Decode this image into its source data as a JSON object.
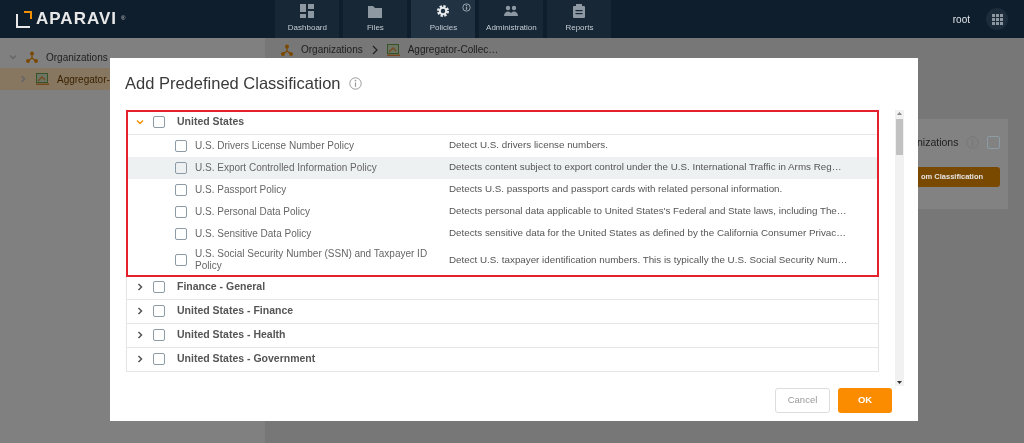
{
  "app": {
    "logo_text": "APARAVI",
    "logo_mark": "®",
    "user": "root"
  },
  "nav": [
    {
      "label": "Dashboard",
      "selected": false,
      "info": false
    },
    {
      "label": "Files",
      "selected": false,
      "info": false
    },
    {
      "label": "Policies",
      "selected": true,
      "info": true
    },
    {
      "label": "Administration",
      "selected": false,
      "info": false
    },
    {
      "label": "Reports",
      "selected": false,
      "info": false
    }
  ],
  "sidebar": {
    "items": [
      {
        "label": "Organizations",
        "expanded": true,
        "selected": false,
        "children": [
          {
            "label": "Aggregator-",
            "expanded": false,
            "selected": true
          }
        ]
      }
    ]
  },
  "breadcrumb": [
    "Organizations",
    "Aggregator-Collec…"
  ],
  "side_panel": {
    "title": "nizations",
    "checked": false,
    "button": "om Classification"
  },
  "dialog": {
    "title": "Add Predefined Classification",
    "groups": [
      {
        "name": "United States",
        "expanded": true,
        "checked": false,
        "outlined": true,
        "children": [
          {
            "name": "U.S. Drivers License Number Policy",
            "description": "Detect U.S. drivers license numbers.",
            "checked": false,
            "highlighted": false
          },
          {
            "name": "U.S. Export Controlled Information Policy",
            "description": "Detects content subject to export control under the U.S. International Traffic in Arms Reg…",
            "checked": false,
            "highlighted": true
          },
          {
            "name": "U.S. Passport Policy",
            "description": "Detects U.S. passports and passport cards with related personal information.",
            "checked": false,
            "highlighted": false
          },
          {
            "name": "U.S. Personal Data Policy",
            "description": "Detects personal data applicable to United States's Federal and State laws, including The…",
            "checked": false,
            "highlighted": false
          },
          {
            "name": "U.S. Sensitive Data Policy",
            "description": "Detects sensitive data for the United States as defined by the California Consumer Privac…",
            "checked": false,
            "highlighted": false
          },
          {
            "name": "U.S. Social Security Number (SSN) and Taxpayer ID Policy",
            "description": "Detect U.S. taxpayer identification numbers. This is typically the U.S. Social Security Num…",
            "checked": false,
            "highlighted": false
          }
        ]
      },
      {
        "name": "Finance - General",
        "expanded": false,
        "checked": false,
        "outlined": false
      },
      {
        "name": "United States - Finance",
        "expanded": false,
        "checked": false,
        "outlined": false
      },
      {
        "name": "United States - Health",
        "expanded": false,
        "checked": false,
        "outlined": false
      },
      {
        "name": "United States - Government",
        "expanded": false,
        "checked": false,
        "outlined": false
      }
    ],
    "buttons": [
      {
        "label": "Cancel",
        "kind": "secondary"
      },
      {
        "label": "OK",
        "kind": "primary"
      }
    ]
  }
}
